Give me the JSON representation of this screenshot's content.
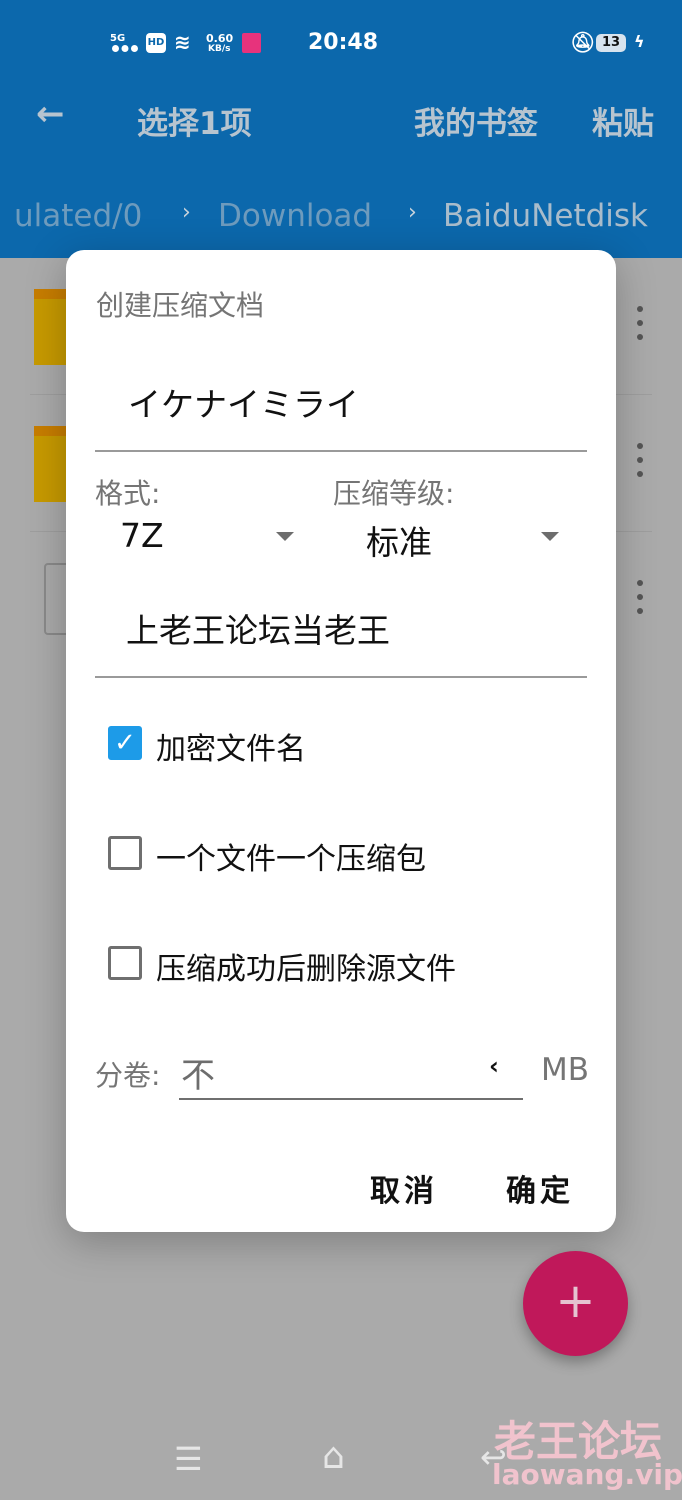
{
  "status_bar": {
    "network": "5G",
    "hd": "HD",
    "speed_value": "0.60",
    "speed_unit": "KB/s",
    "time": "20:48",
    "battery": "13"
  },
  "app_bar": {
    "title": "选择1项",
    "bookmarks": "我的书签",
    "paste": "粘贴"
  },
  "breadcrumb": [
    "ulated/0",
    "Download",
    "BaiduNetdisk"
  ],
  "dialog": {
    "title": "创建压缩文档",
    "archive_name": "イケナイミライ",
    "format_label": "格式:",
    "format_value": "7Z",
    "level_label": "压缩等级:",
    "level_value": "标准",
    "password": "上老王论坛当老王",
    "checkboxes": [
      {
        "label": "加密文件名",
        "checked": true
      },
      {
        "label": "一个文件一个压缩包",
        "checked": false
      },
      {
        "label": "压缩成功后删除源文件",
        "checked": false
      }
    ],
    "split_label": "分卷:",
    "split_value": "不",
    "split_unit": "MB",
    "cancel": "取消",
    "ok": "确定"
  },
  "fab": "+",
  "watermark": {
    "line1": "老王论坛",
    "line2": "laowang.vip"
  },
  "colors": {
    "app_bar": "#0c68ac",
    "fab": "#c0185a",
    "checkbox": "#1d9be8"
  }
}
